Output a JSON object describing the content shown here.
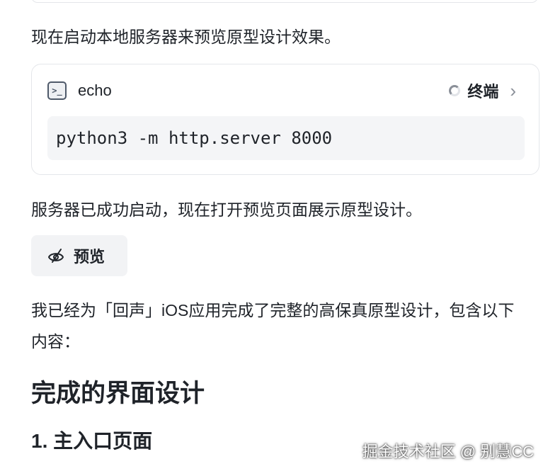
{
  "messages": {
    "intro": "现在启动本地服务器来预览原型设计效果。",
    "started": "服务器已成功启动，现在打开预览页面展示原型设计。",
    "summary": "我已经为「回声」iOS应用完成了完整的高保真原型设计，包含以下内容："
  },
  "tool_call": {
    "icon": "terminal-icon",
    "icon_glyph": ">_",
    "name": "echo",
    "status_icon": "loading-spinner-icon",
    "status_label": "终端",
    "command": "python3 -m http.server 8000"
  },
  "preview_button": {
    "icon": "eye-icon",
    "label": "预览"
  },
  "sections": {
    "heading": "完成的界面设计",
    "subheading": "1. 主入口页面"
  },
  "watermark": "掘金技术社区 @ 别慧CC"
}
